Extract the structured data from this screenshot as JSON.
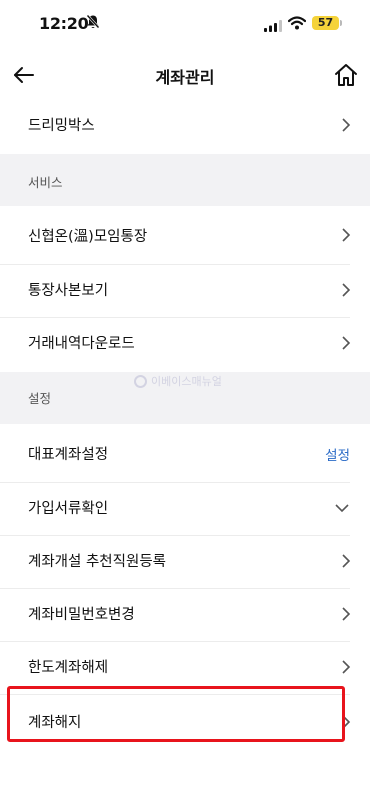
{
  "status_bar": {
    "time": "12:20",
    "battery": "57"
  },
  "header": {
    "title": "계좌관리",
    "back_icon": "arrow-left-icon",
    "home_icon": "home-icon"
  },
  "top_item": {
    "label": "드리밍박스"
  },
  "sections": [
    {
      "title": "서비스",
      "items": [
        {
          "label": "신협온(溫)모임통장"
        },
        {
          "label": "통장사본보기"
        },
        {
          "label": "거래내역다운로드"
        }
      ]
    },
    {
      "title": "설정",
      "items": [
        {
          "label": "대표계좌설정",
          "action": "설정"
        },
        {
          "label": "가입서류확인"
        },
        {
          "label": "계좌개설 추천직원등록"
        },
        {
          "label": "계좌비밀번호변경"
        },
        {
          "label": "한도계좌해제"
        },
        {
          "label": "계좌해지"
        }
      ]
    }
  ],
  "watermark": "이베이스매뉴얼",
  "colors": {
    "accent": "#2c6cc7",
    "highlight": "#e8141c",
    "section_bg": "#f2f2f4",
    "battery": "#f5d33a"
  }
}
